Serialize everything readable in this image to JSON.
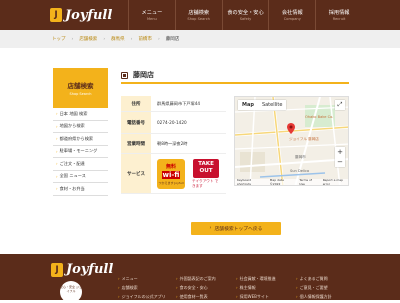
{
  "header": {
    "logo_text": "Joyfull",
    "logo_badge": "J",
    "nav": [
      {
        "label": "メニュー",
        "sub": "Menu"
      },
      {
        "label": "店舗検索",
        "sub": "Shop Search"
      },
      {
        "label": "食の安全・安心",
        "sub": "Safety"
      },
      {
        "label": "会社情報",
        "sub": "Company"
      },
      {
        "label": "採用情報",
        "sub": "Recruit"
      }
    ]
  },
  "breadcrumb": [
    "トップ",
    "店舗検索",
    "群馬県",
    "前橋市",
    "藤岡店"
  ],
  "sidebar": {
    "title": "店舗検索",
    "subtitle": "Shop Search",
    "items": [
      "日本 地図 検索",
      "地図から検索",
      "都道府県から検索",
      "駐車場・モーニング",
      "ご注文・配達",
      "全国 ニュース",
      "食材・お弁当"
    ]
  },
  "store": {
    "name": "藤岡店",
    "rows": [
      {
        "key": "住所",
        "value": "群馬県藤岡市下戸塚44"
      },
      {
        "key": "電話番号",
        "value": "0274-20-1420"
      },
      {
        "key": "営業時間",
        "value": "朝8時～深夜2時"
      },
      {
        "key": "サービス",
        "value": ""
      }
    ],
    "wifi": {
      "line1": "無料",
      "line2": "wi-fi",
      "line3": "つかえます Joyfull"
    },
    "takeout": {
      "line1": "TAKE",
      "line2": "OUT",
      "line3": "テイクアウト できます"
    }
  },
  "map": {
    "tab_map": "Map",
    "tab_sat": "Satellite",
    "fullscreen": "⤢",
    "zoom_in": "+",
    "zoom_out": "−",
    "labels": {
      "place1": "Ohako Bake Co.",
      "place2": "ジョイフル 藤岡店",
      "place3": "藤岡市",
      "place4": "Sun Delica"
    },
    "footer": [
      "Keyboard shortcuts",
      "Map data ©2022",
      "Terms of Use",
      "Report a map error"
    ],
    "pin_color": "#e53935"
  },
  "back_button": "店舗検索トップへ戻る",
  "footer": {
    "logo_text": "Joyfull",
    "emblem_text": "安心・安全 ジョイフル",
    "col1": [
      "メニュー",
      "店舗検索",
      "ジョイフルの公式アプリ"
    ],
    "col2": [
      "外国語表記のご案内",
      "食の安全・安心",
      "使用食材一覧表"
    ],
    "col3": [
      "社会貢献・環境推進",
      "株主情報",
      "採用WEBサイト"
    ],
    "col4": [
      "よくあるご質問",
      "ご意見・ご要望",
      "個人情報保護方針"
    ]
  },
  "colors": {
    "brand_brown": "#5b2c1a",
    "brand_yellow": "#f3b21b",
    "takeout_red": "#c8102e"
  }
}
